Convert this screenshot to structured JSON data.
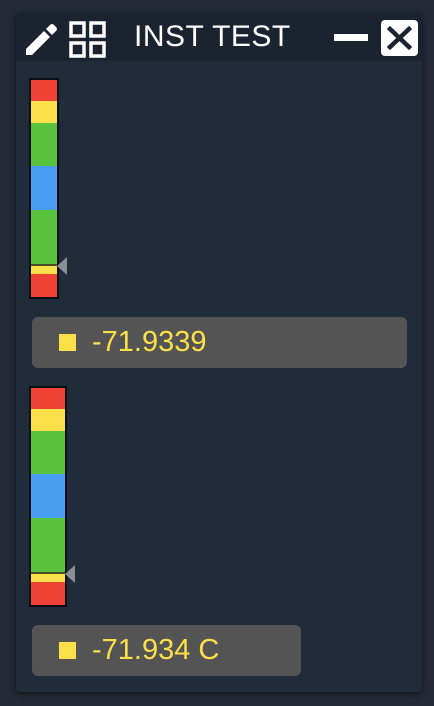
{
  "window": {
    "title": "INST TEST",
    "icons": {
      "edit": "pencil-icon",
      "layout": "grid-icon",
      "minimize": "minimize-icon",
      "close": "close-icon"
    }
  },
  "gauges": [
    {
      "value_text": "-71.9339",
      "marker_level": 0.15,
      "swatch_color": "#fbe04a"
    },
    {
      "value_text": "-71.934 C",
      "marker_level": 0.15,
      "swatch_color": "#fbe04a"
    }
  ],
  "colors": {
    "red": "#ef4136",
    "yellow": "#fbe04a",
    "green": "#5bc23e",
    "blue": "#4a9ef2",
    "value_text": "#fbe04a"
  }
}
